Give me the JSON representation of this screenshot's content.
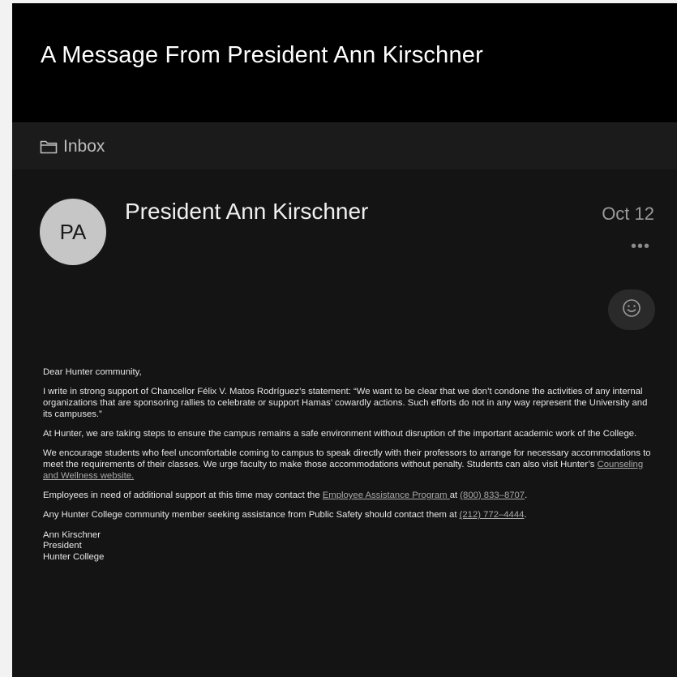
{
  "header": {
    "subject": "A Message From President Ann Kirschner"
  },
  "folder": {
    "icon": "folder-icon",
    "label": "Inbox"
  },
  "message": {
    "avatar_initials": "PA",
    "sender": "President Ann Kirschner",
    "date": "Oct 12",
    "more_icon": "more-horizontal-icon",
    "more_label": "•••",
    "reaction_icon": "smiley-icon"
  },
  "body": {
    "greeting": "Dear Hunter community,",
    "p1": "I write in strong support of Chancellor Félix V. Matos Rodríguez’s statement: “We want to be clear that we don’t condone the activities of any internal organizations that are sponsoring rallies to celebrate or support Hamas’ cowardly actions. Such efforts do not in any way represent the University and its campuses.”",
    "p2": "At Hunter, we are taking steps to ensure the campus remains a safe environment without disruption of the important academic work of the College.",
    "p3_text": "We encourage students who feel uncomfortable coming to campus to speak directly with their professors to arrange for necessary accommodations to meet the requirements of their classes. We urge faculty to make those accommodations without penalty. Students can also visit Hunter’s ",
    "p3_link": "Counseling and Wellness website.",
    "p4_text": "Employees in need of additional support at this time may contact the ",
    "p4_link": "Employee Assistance Program ",
    "p4_mid": "at ",
    "p4_phone": "(800) 833–8707",
    "p4_end": ".",
    "p5_text": "Any Hunter College community member seeking assistance from Public Safety should contact them at ",
    "p5_phone": "(212) 772–4444",
    "p5_end": ".",
    "sig_name": "Ann Kirschner",
    "sig_title": "President",
    "sig_org": "Hunter College"
  }
}
